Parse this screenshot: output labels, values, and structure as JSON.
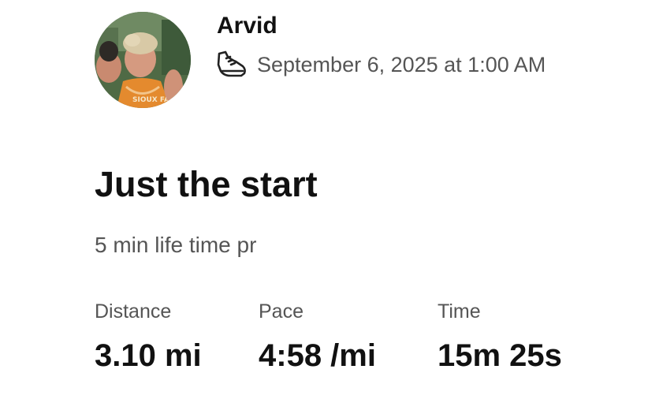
{
  "athlete": {
    "name": "Arvid",
    "avatar": "profile-photo"
  },
  "activity": {
    "sport_icon": "running-shoe-icon",
    "date": "September 6, 2025 at 1:00 AM",
    "title": "Just the start",
    "description": "5 min life time pr"
  },
  "stats": [
    {
      "label": "Distance",
      "value": "3.10 mi"
    },
    {
      "label": "Pace",
      "value": "4:58 /mi"
    },
    {
      "label": "Time",
      "value": "15m 25s"
    }
  ],
  "colors": {
    "text_primary": "#111111",
    "text_secondary": "#555555",
    "background": "#ffffff"
  }
}
